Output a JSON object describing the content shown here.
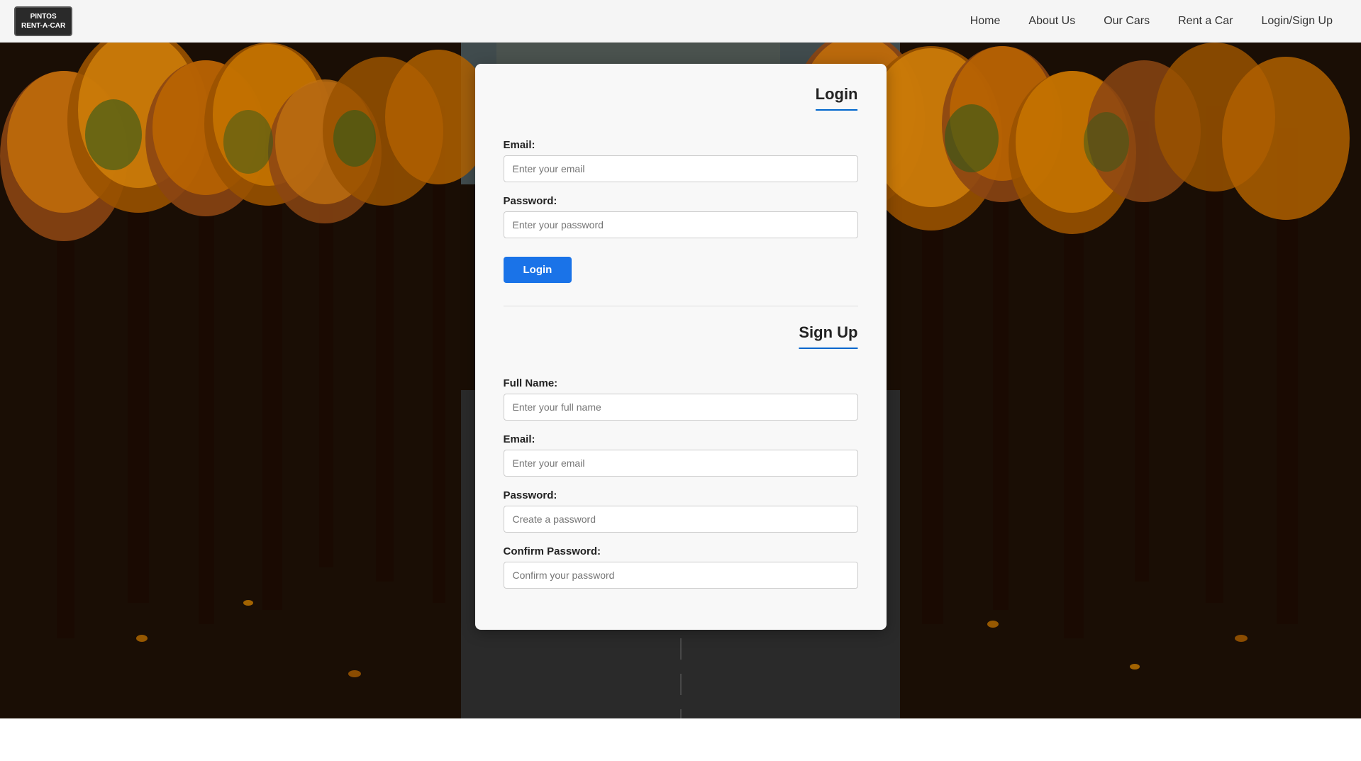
{
  "brand": {
    "line1": "PINTOS",
    "line2": "RENT-A-CAR"
  },
  "navbar": {
    "links": [
      {
        "id": "home",
        "label": "Home"
      },
      {
        "id": "about",
        "label": "About Us"
      },
      {
        "id": "cars",
        "label": "Our Cars"
      },
      {
        "id": "rent",
        "label": "Rent a Car"
      },
      {
        "id": "login",
        "label": "Login/Sign Up"
      }
    ]
  },
  "login_section": {
    "title": "Login",
    "email_label": "Email:",
    "email_placeholder": "Enter your email",
    "password_label": "Password:",
    "password_placeholder": "Enter your password",
    "button_label": "Login"
  },
  "signup_section": {
    "title": "Sign Up",
    "fullname_label": "Full Name:",
    "fullname_placeholder": "Enter your full name",
    "email_label": "Email:",
    "email_placeholder": "Enter your email",
    "password_label": "Password:",
    "password_placeholder": "Create a password",
    "confirm_label": "Confirm Password:",
    "confirm_placeholder": "Confirm your password"
  }
}
